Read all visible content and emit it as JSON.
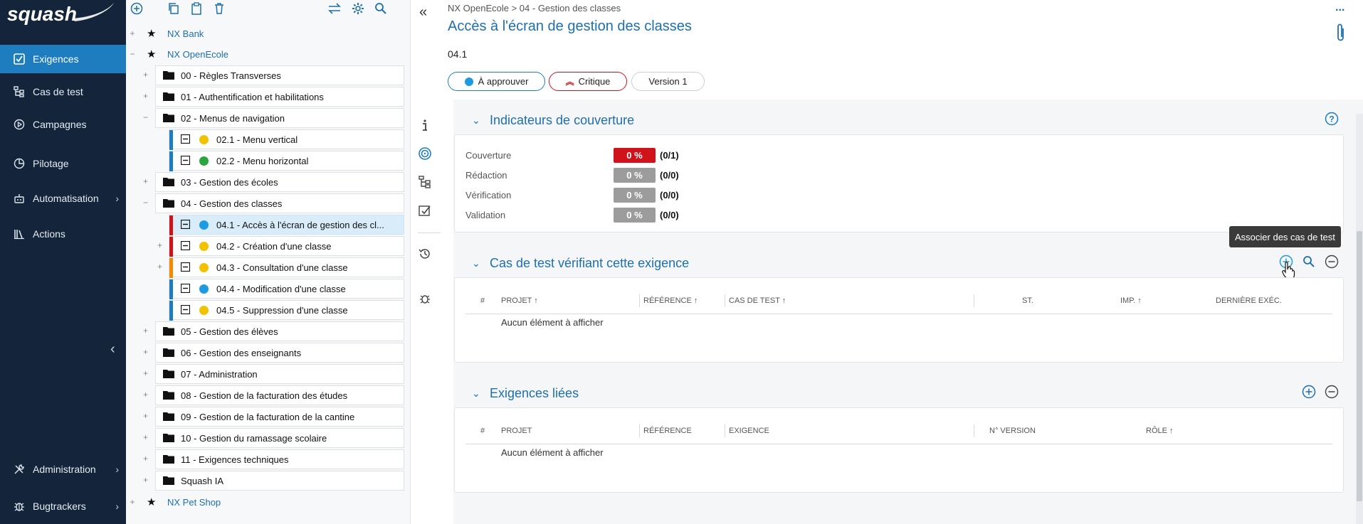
{
  "brand": {
    "logo_text": "squash"
  },
  "nav": {
    "items": [
      {
        "label": "Exigences",
        "icon": "requirements-icon",
        "active": true
      },
      {
        "label": "Cas de test",
        "icon": "test-case-icon"
      },
      {
        "label": "Campagnes",
        "icon": "campaign-icon"
      },
      {
        "label": "Pilotage",
        "icon": "piloting-icon"
      },
      {
        "label": "Automatisation",
        "icon": "robot-icon",
        "chevron": "›"
      },
      {
        "label": "Actions",
        "icon": "library-icon"
      },
      {
        "label": "Administration",
        "icon": "tools-icon",
        "chevron": "›"
      },
      {
        "label": "Bugtrackers",
        "icon": "bug-icon",
        "chevron": "›"
      }
    ],
    "collapse_glyph": "‹"
  },
  "tree": {
    "projects": [
      "NX Bank",
      "NX OpenEcole",
      "NX Pet Shop"
    ],
    "folders": [
      "00 - Règles Transverses",
      "01 - Authentification et habilitations",
      "02 - Menus de navigation",
      "03 - Gestion des écoles",
      "04 - Gestion des classes",
      "05 - Gestion des élèves",
      "06 - Gestion des enseignants",
      "07 - Administration",
      "08 - Gestion de la facturation des études",
      "09 - Gestion de la facturation de la cantine",
      "10 - Gestion du ramassage scolaire",
      "11 - Exigences techniques",
      "Squash IA"
    ],
    "reqs_02": [
      {
        "label": "02.1 - Menu vertical",
        "status_color": "#f2c200",
        "crit_color": "#1e7dbf"
      },
      {
        "label": "02.2 - Menu horizontal",
        "status_color": "#2aa63c",
        "crit_color": "#1e7dbf"
      }
    ],
    "reqs_04": [
      {
        "label": "04.1 - Accès à l'écran de gestion des cl...",
        "status_color": "#1e9be0",
        "crit_color": "#d0121b"
      },
      {
        "label": "04.2 - Création d'une classe",
        "status_color": "#f2c200",
        "crit_color": "#d0121b"
      },
      {
        "label": "04.3 - Consultation d'une classe",
        "status_color": "#f2c200",
        "crit_color": "#f28b00"
      },
      {
        "label": "04.4 - Modification d'une classe",
        "status_color": "#1e9be0",
        "crit_color": "#1e7dbf"
      },
      {
        "label": "04.5 - Suppression d'une classe",
        "status_color": "#f2c200",
        "crit_color": "#1e7dbf"
      }
    ]
  },
  "header": {
    "breadcrumb": "NX OpenEcole > 04 - Gestion des classes",
    "title": "Accès à l'écran de gestion des classes",
    "reference": "04.1",
    "status_label": "À approuver",
    "criticality_label": "Critique",
    "version_label": "Version 1",
    "more_glyph": "..."
  },
  "coverage": {
    "title": "Indicateurs de couverture",
    "rows": [
      {
        "label": "Couverture",
        "badge": "0 %",
        "ratio": "(0/1)",
        "color": "#d0121b"
      },
      {
        "label": "Rédaction",
        "badge": "0 %",
        "ratio": "(0/0)",
        "color": "#9c9c9c"
      },
      {
        "label": "Vérification",
        "badge": "0 %",
        "ratio": "(0/0)",
        "color": "#9c9c9c"
      },
      {
        "label": "Validation",
        "badge": "0 %",
        "ratio": "(0/0)",
        "color": "#9c9c9c"
      }
    ]
  },
  "testcases": {
    "title": "Cas de test vérifiant cette exigence",
    "headers": [
      "#",
      "PROJET ↑",
      "RÉFÉRENCE ↑",
      "CAS DE TEST ↑",
      "ST.",
      "IMP. ↑",
      "DERNIÈRE EXÉC."
    ],
    "empty": "Aucun élément à afficher",
    "tooltip": "Associer des cas de test"
  },
  "linked": {
    "title": "Exigences liées",
    "headers": [
      "#",
      "PROJET",
      "RÉFÉRENCE",
      "EXIGENCE",
      "N° VERSION",
      "RÔLE ↑"
    ],
    "empty": "Aucun élément à afficher"
  }
}
